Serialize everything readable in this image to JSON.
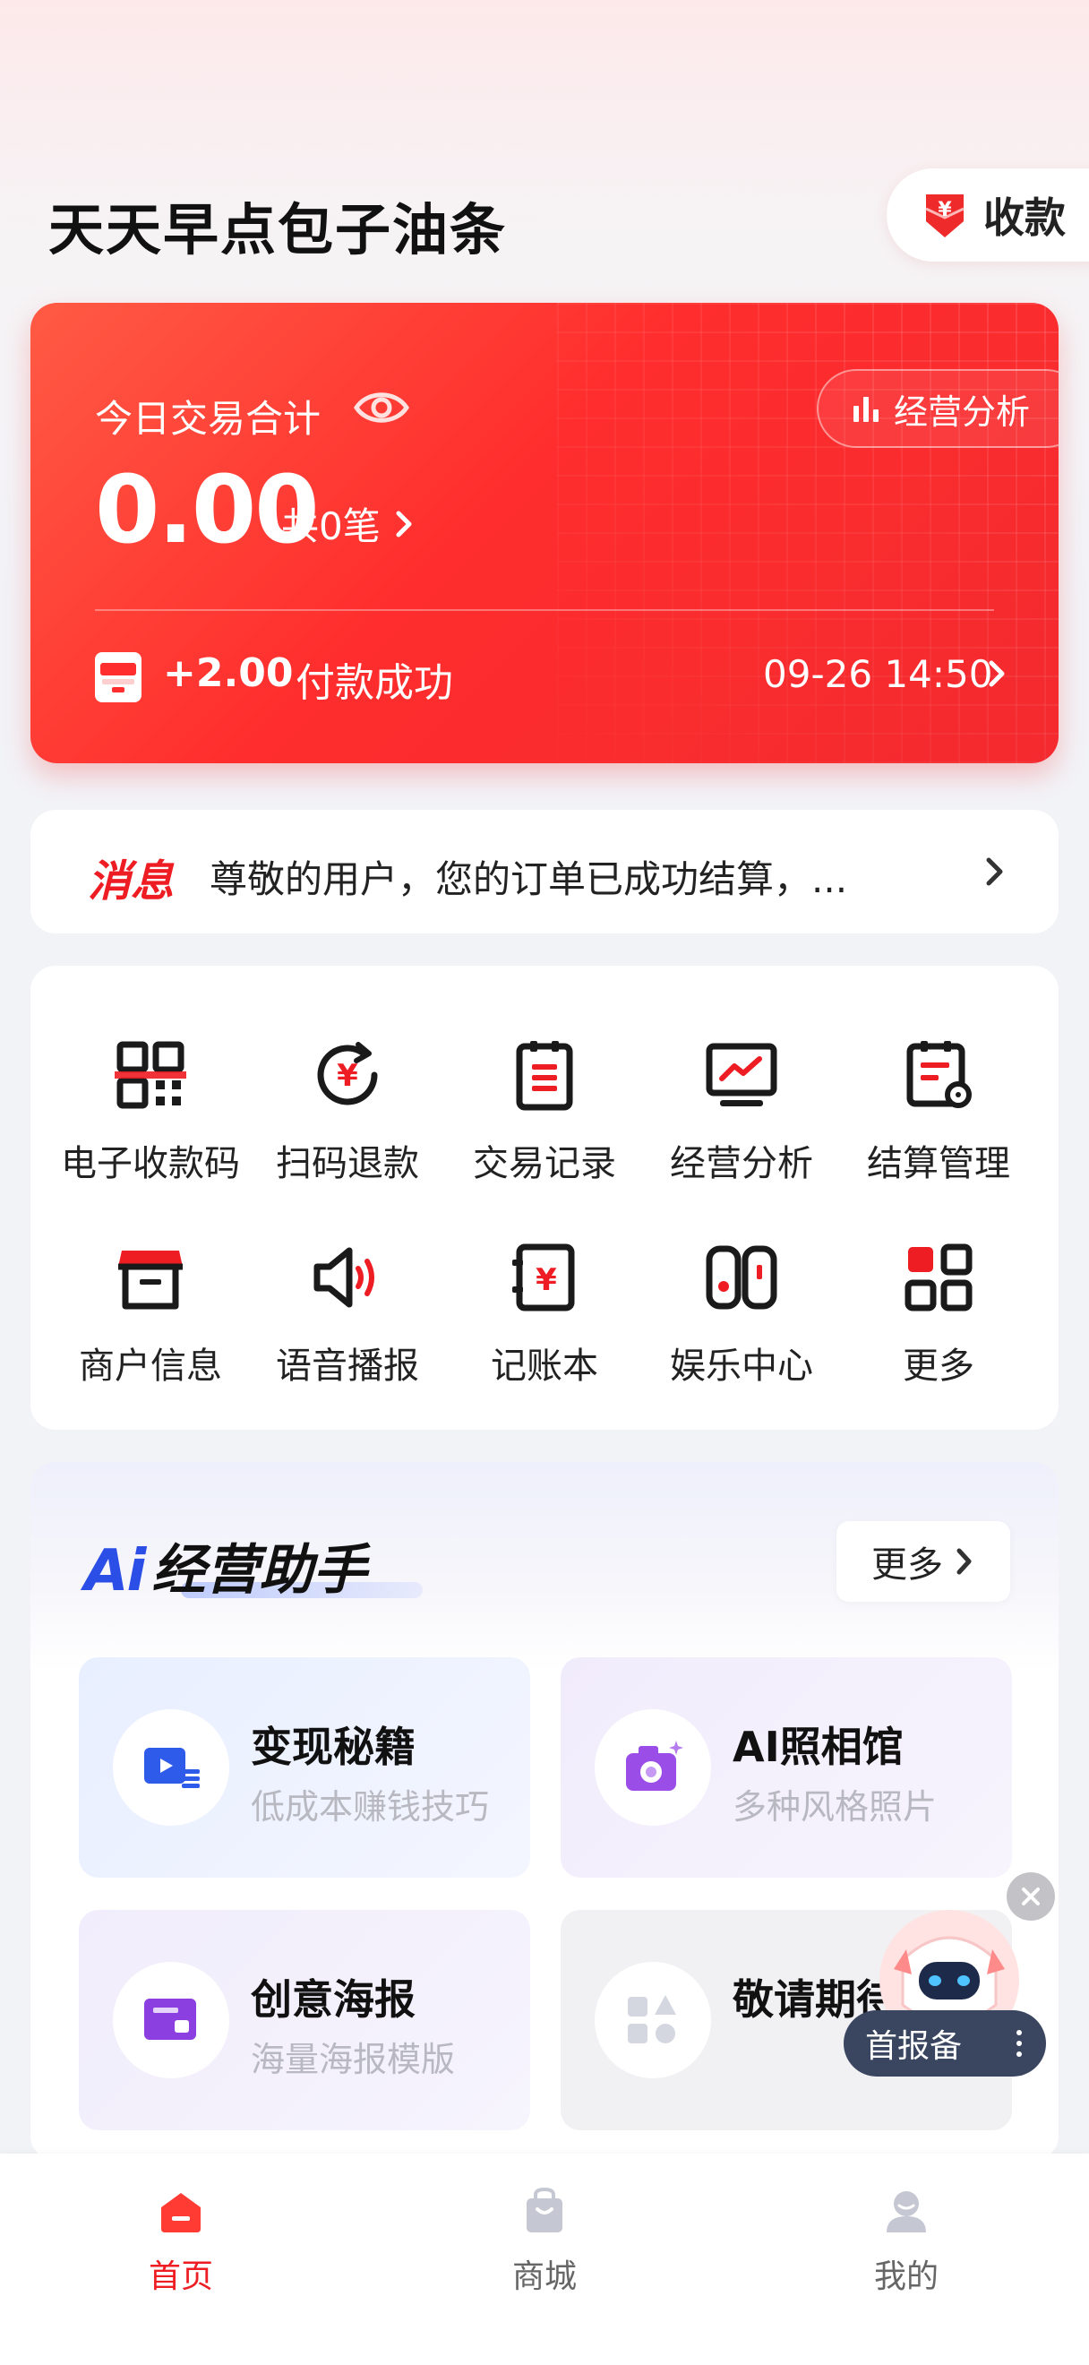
{
  "header": {
    "shop_name": "天天早点包子油条",
    "collect_button": "收款",
    "collect_icon": "shield-yuan-icon"
  },
  "summary_card": {
    "title": "今日交易合计",
    "amount": "0.00",
    "count_text": "共0笔",
    "analysis_button": "经营分析",
    "last_transaction": {
      "amount": "+2.00",
      "status": "付款成功",
      "time": "09-26 14:50"
    },
    "accent_color": "#ff2d2d"
  },
  "message": {
    "tag": "消息",
    "text": "尊敬的用户，您的订单已成功结算，..."
  },
  "functions": [
    {
      "label": "电子收款码",
      "icon": "qr-code-icon"
    },
    {
      "label": "扫码退款",
      "icon": "refund-icon"
    },
    {
      "label": "交易记录",
      "icon": "record-icon"
    },
    {
      "label": "经营分析",
      "icon": "monitor-chart-icon"
    },
    {
      "label": "结算管理",
      "icon": "settlement-icon"
    },
    {
      "label": "商户信息",
      "icon": "shop-icon"
    },
    {
      "label": "语音播报",
      "icon": "speaker-icon"
    },
    {
      "label": "记账本",
      "icon": "ledger-icon"
    },
    {
      "label": "娱乐中心",
      "icon": "gamepad-icon"
    },
    {
      "label": "更多",
      "icon": "more-grid-icon"
    }
  ],
  "ai_assistant": {
    "logo": "Ai",
    "title": "经营助手",
    "more_button": "更多",
    "cards": [
      {
        "title": "变现秘籍",
        "subtitle": "低成本赚钱技巧",
        "icon": "video-list-icon"
      },
      {
        "title": "AI照相馆",
        "subtitle": "多种风格照片",
        "icon": "camera-icon"
      },
      {
        "title": "创意海报",
        "subtitle": "海量海报模版",
        "icon": "poster-icon"
      },
      {
        "title": "敬请期待",
        "subtitle": "",
        "icon": "shapes-icon"
      }
    ]
  },
  "floating": {
    "tag": "首报备"
  },
  "bottom_nav": [
    {
      "label": "首页",
      "icon": "home-icon",
      "active": true
    },
    {
      "label": "商城",
      "icon": "shopping-bag-icon",
      "active": false
    },
    {
      "label": "我的",
      "icon": "user-icon",
      "active": false
    }
  ]
}
